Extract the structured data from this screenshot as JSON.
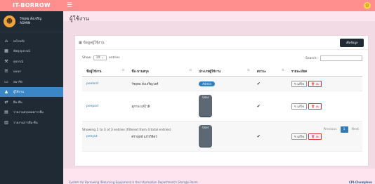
{
  "app": {
    "brand": "IT-BORROW"
  },
  "colors": {
    "accent": "#ff8f8f",
    "sidebar": "#1f2a35",
    "active": "#3b86c6",
    "link": "#2a7ab3"
  },
  "user": {
    "name": "วีรยุทธ ดั่งเจริญ",
    "role": "ADMIN"
  },
  "sidebar": {
    "items": [
      {
        "label": "หน้าหลัก",
        "icon": "home-icon"
      },
      {
        "label": "พัสดุ/อุปกรณ์",
        "icon": "grid-icon"
      },
      {
        "label": "ยุปกรณ์",
        "icon": "tools-icon"
      },
      {
        "label": "แผนก",
        "icon": "list-icon"
      },
      {
        "label": "สมาชิก",
        "icon": "id-card-icon"
      },
      {
        "label": "ผู้ใช้งาน",
        "icon": "user-icon"
      },
      {
        "label": "ยืม-คืน",
        "icon": "shuffle-icon"
      },
      {
        "label": "รายงานสรุปยอดการยืม",
        "icon": "doc-icon"
      },
      {
        "label": "รายงานการยืม-คืน",
        "icon": "table-icon"
      }
    ]
  },
  "page": {
    "title": "ผู้ใช้งาน"
  },
  "card": {
    "title": "ข้อมูลผู้ใช้งาน",
    "add_label": "เพิ่มข้อมูล"
  },
  "table": {
    "show_prefix": "Show",
    "show_value": "10",
    "show_suffix": "entries",
    "search_label": "Search:",
    "columns": [
      "ชื่อผู้ใช้งาน",
      "ชื่อ-นามสกุล",
      "ประเภทผู้ใช้งาน",
      "สถานะ",
      "รายละเอียด"
    ],
    "rows": [
      {
        "username": "peelord",
        "fullname": "วีรยุทธ ดั่งเจริญวงศ์",
        "type": "Admin",
        "status": "✔",
        "edit": "แก้ไข",
        "delete": "ลบ"
      },
      {
        "username": "peepod",
        "fullname": "สุภาพ แพ้ไวดิ",
        "type": "User",
        "status": "✔",
        "edit": "แก้ไข",
        "delete": "ลบ"
      },
      {
        "username": "peeyut",
        "fullname": "ศรายุทธ์ แก้วกิจิตร",
        "type": "User",
        "status": "✔",
        "edit": "แก้ไข",
        "delete": "ลบ"
      }
    ],
    "info": "Showing 1 to 3 of 3 entries (filtered from 4 total entries)",
    "pagination": {
      "prev": "Previous",
      "page": "1",
      "next": "Next"
    }
  },
  "footer": {
    "left": "System for Borrowing /Returning Equipment in the Information Department's Storage Room",
    "right": "CPI-Chumphon"
  }
}
